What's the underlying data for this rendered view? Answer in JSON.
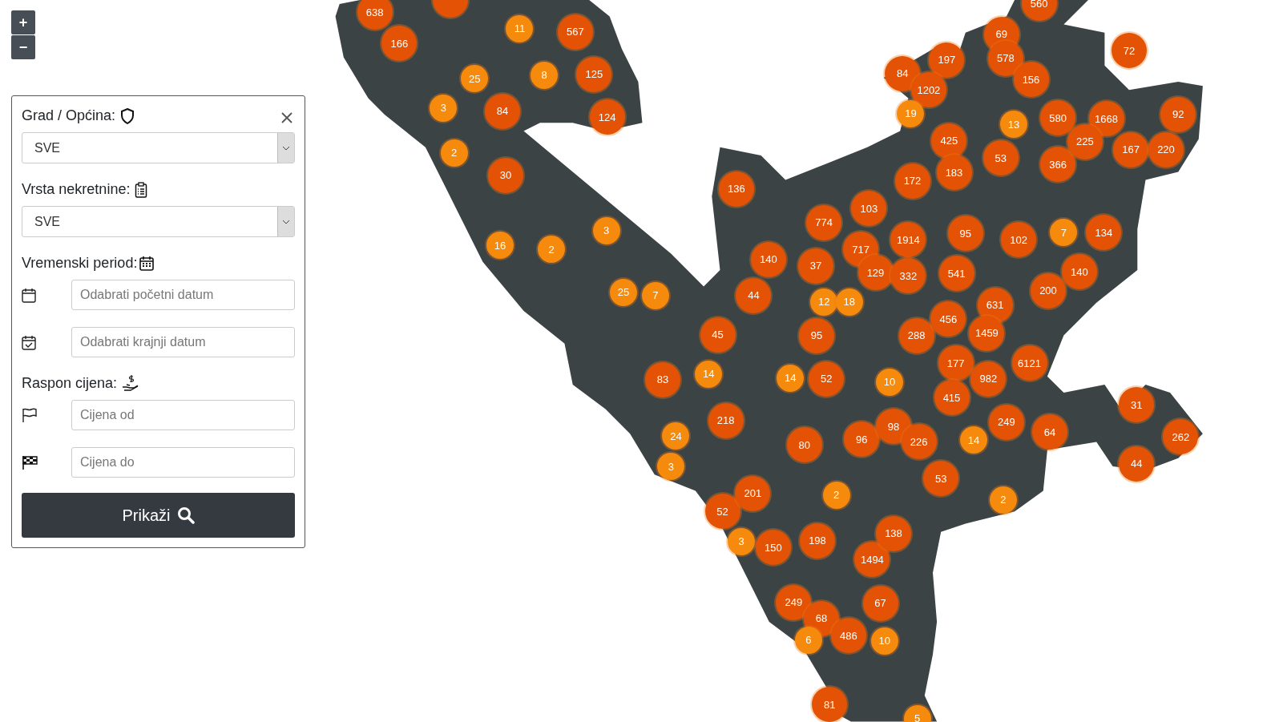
{
  "zoom_controls": [
    {
      "label": "+"
    },
    {
      "label": "−"
    }
  ],
  "filter_panel": {
    "city": {
      "label": "Grad / Općina:",
      "value": "SVE"
    },
    "property_type": {
      "label": "Vrsta nekretnine:",
      "value": "SVE"
    },
    "period": {
      "label": "Vremenski period:",
      "start_placeholder": "Odabrati početni datum",
      "end_placeholder": "Odabrati krajnji datum"
    },
    "price": {
      "label": "Raspon cijena:",
      "from_placeholder": "Cijena od",
      "to_placeholder": "Cijena do"
    },
    "submit": "Prikaži"
  },
  "markers": [
    {
      "label": "638",
      "color": "#e35205"
    },
    {
      "color": "#e35205"
    },
    {
      "label": "560",
      "color": "#e35205"
    },
    {
      "label": "166",
      "color": "#e35205"
    },
    {
      "label": "11",
      "color": "#f58a0c"
    },
    {
      "label": "567",
      "color": "#e35205"
    },
    {
      "label": "69",
      "color": "#e35205"
    },
    {
      "label": "197",
      "color": "#e35205"
    },
    {
      "label": "578",
      "color": "#e35205"
    },
    {
      "label": "72",
      "color": "#e35205"
    },
    {
      "label": "25",
      "color": "#f58a0c"
    },
    {
      "label": "8",
      "color": "#f58a0c"
    },
    {
      "label": "125",
      "color": "#e35205"
    },
    {
      "label": "84",
      "color": "#e35205"
    },
    {
      "label": "1202",
      "color": "#e35205"
    },
    {
      "label": "156",
      "color": "#e35205"
    },
    {
      "label": "3",
      "color": "#f58a0c"
    },
    {
      "label": "84",
      "color": "#e35205"
    },
    {
      "label": "124",
      "color": "#e35205"
    },
    {
      "label": "19",
      "color": "#f58a0c"
    },
    {
      "label": "13",
      "color": "#f58a0c"
    },
    {
      "label": "580",
      "color": "#e35205"
    },
    {
      "label": "1668",
      "color": "#e35205"
    },
    {
      "label": "92",
      "color": "#e35205"
    },
    {
      "label": "2",
      "color": "#f58a0c"
    },
    {
      "label": "425",
      "color": "#e35205"
    },
    {
      "label": "53",
      "color": "#e35205"
    },
    {
      "label": "366",
      "color": "#e35205"
    },
    {
      "label": "225",
      "color": "#e35205"
    },
    {
      "label": "167",
      "color": "#e35205"
    },
    {
      "label": "220",
      "color": "#e35205"
    },
    {
      "label": "30",
      "color": "#e35205"
    },
    {
      "label": "172",
      "color": "#e35205"
    },
    {
      "label": "183",
      "color": "#e35205"
    },
    {
      "label": "136",
      "color": "#e35205"
    },
    {
      "label": "103",
      "color": "#e35205"
    },
    {
      "label": "3",
      "color": "#f58a0c"
    },
    {
      "label": "774",
      "color": "#e35205"
    },
    {
      "label": "1914",
      "color": "#e35205"
    },
    {
      "label": "95",
      "color": "#e35205"
    },
    {
      "label": "102",
      "color": "#e35205"
    },
    {
      "label": "7",
      "color": "#f58a0c"
    },
    {
      "label": "134",
      "color": "#e35205"
    },
    {
      "label": "16",
      "color": "#f58a0c"
    },
    {
      "label": "2",
      "color": "#f58a0c"
    },
    {
      "label": "140",
      "color": "#e35205"
    },
    {
      "label": "37",
      "color": "#e35205"
    },
    {
      "label": "717",
      "color": "#e35205"
    },
    {
      "label": "129",
      "color": "#e35205"
    },
    {
      "label": "332",
      "color": "#e35205"
    },
    {
      "label": "541",
      "color": "#e35205"
    },
    {
      "label": "200",
      "color": "#e35205"
    },
    {
      "label": "140",
      "color": "#e35205"
    },
    {
      "label": "25",
      "color": "#f58a0c"
    },
    {
      "label": "7",
      "color": "#f58a0c"
    },
    {
      "label": "44",
      "color": "#e35205"
    },
    {
      "label": "12",
      "color": "#f58a0c"
    },
    {
      "label": "18",
      "color": "#f58a0c"
    },
    {
      "label": "631",
      "color": "#e35205"
    },
    {
      "label": "45",
      "color": "#e35205"
    },
    {
      "label": "95",
      "color": "#e35205"
    },
    {
      "label": "288",
      "color": "#e35205"
    },
    {
      "label": "456",
      "color": "#e35205"
    },
    {
      "label": "1459",
      "color": "#e35205"
    },
    {
      "label": "83",
      "color": "#e35205"
    },
    {
      "label": "14",
      "color": "#f58a0c"
    },
    {
      "label": "14",
      "color": "#f58a0c"
    },
    {
      "label": "52",
      "color": "#e35205"
    },
    {
      "label": "10",
      "color": "#f58a0c"
    },
    {
      "label": "177",
      "color": "#e35205"
    },
    {
      "label": "982",
      "color": "#e35205"
    },
    {
      "label": "6121",
      "color": "#e35205"
    },
    {
      "label": "415",
      "color": "#e35205"
    },
    {
      "label": "31",
      "color": "#e35205"
    },
    {
      "label": "24",
      "color": "#f58a0c"
    },
    {
      "label": "218",
      "color": "#e35205"
    },
    {
      "label": "96",
      "color": "#e35205"
    },
    {
      "label": "98",
      "color": "#e35205"
    },
    {
      "label": "226",
      "color": "#e35205"
    },
    {
      "label": "14",
      "color": "#f58a0c"
    },
    {
      "label": "249",
      "color": "#e35205"
    },
    {
      "label": "64",
      "color": "#e35205"
    },
    {
      "label": "262",
      "color": "#e35205"
    },
    {
      "label": "3",
      "color": "#f58a0c"
    },
    {
      "label": "80",
      "color": "#e35205"
    },
    {
      "label": "44",
      "color": "#e35205"
    },
    {
      "label": "52",
      "color": "#e35205"
    },
    {
      "label": "201",
      "color": "#e35205"
    },
    {
      "label": "2",
      "color": "#f58a0c"
    },
    {
      "label": "53",
      "color": "#e35205"
    },
    {
      "label": "2",
      "color": "#f58a0c"
    },
    {
      "label": "3",
      "color": "#f58a0c"
    },
    {
      "label": "150",
      "color": "#e35205"
    },
    {
      "label": "198",
      "color": "#e35205"
    },
    {
      "label": "1494",
      "color": "#e35205"
    },
    {
      "label": "138",
      "color": "#e35205"
    },
    {
      "label": "249",
      "color": "#e35205"
    },
    {
      "label": "68",
      "color": "#e35205"
    },
    {
      "label": "67",
      "color": "#e35205"
    },
    {
      "label": "6",
      "color": "#f58a0c"
    },
    {
      "label": "486",
      "color": "#e35205"
    },
    {
      "label": "10",
      "color": "#f58a0c"
    },
    {
      "label": "81",
      "color": "#e35205"
    },
    {
      "label": "5",
      "color": "#f58a0c"
    }
  ]
}
